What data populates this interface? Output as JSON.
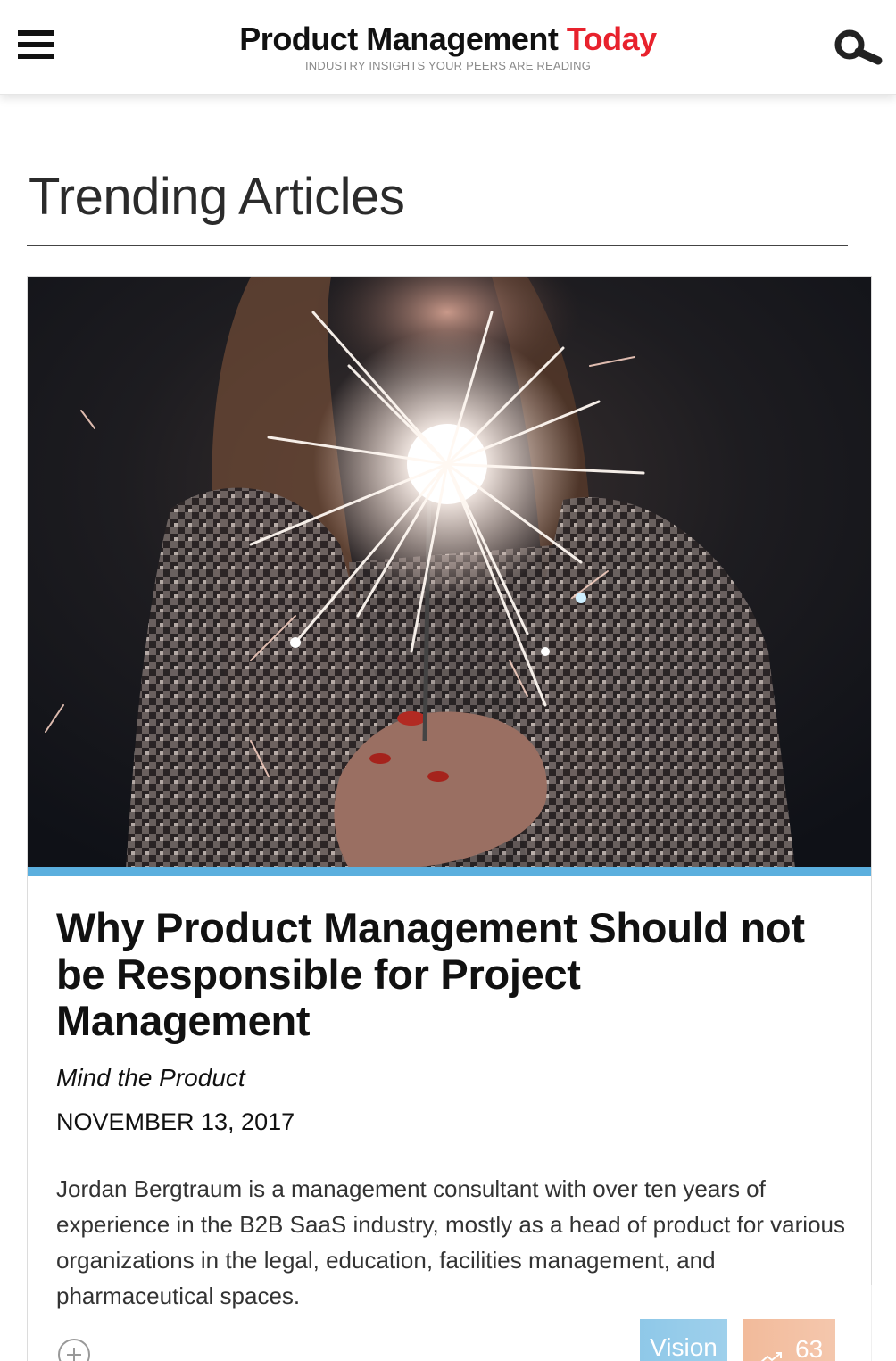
{
  "header": {
    "brand_main": "Product Management",
    "brand_accent": "Today",
    "tagline": "INDUSTRY INSIGHTS YOUR PEERS ARE READING",
    "menu_icon": "hamburger-menu-icon",
    "search_icon": "search-icon"
  },
  "section": {
    "title": "Trending Articles"
  },
  "article": {
    "image_desc_icon": "hero-image",
    "title": "Why Product Management Should not be Responsible for Project Management",
    "source": "Mind the Product",
    "date": "NOVEMBER 13, 2017",
    "excerpt": "Jordan Bergtraum is a management consultant with over ten years of experience in the B2B SaaS industry, mostly as a head of product for various organizations in the legal, education, facilities management, and pharmaceutical spaces.",
    "tag": "Vision",
    "trend_count": "63",
    "add_icon": "plus-circle-icon",
    "trend_icon": "trending-up-icon"
  },
  "colors": {
    "brand_accent": "#e8222d",
    "tag_blue": "#5bafde",
    "trend_orange": "#e8874f"
  }
}
